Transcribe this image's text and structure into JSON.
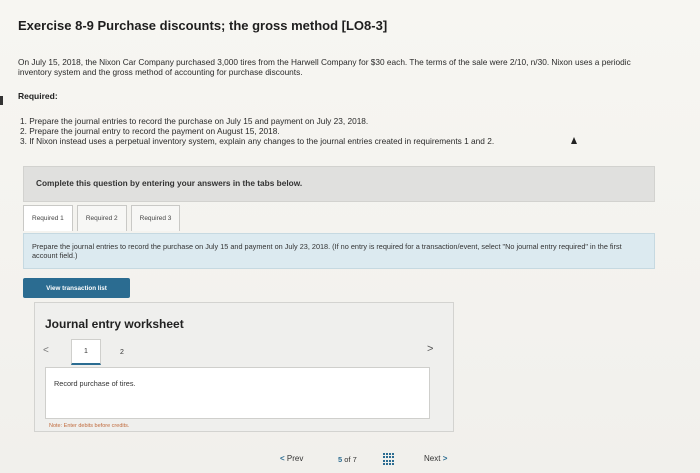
{
  "title": "Exercise 8-9 Purchase discounts; the gross method [LO8-3]",
  "intro": "On July 15, 2018, the Nixon Car Company purchased 3,000 tires from the Harwell Company for $30 each. The terms of the sale were 2/10, n/30. Nixon uses a periodic inventory system and the gross method of accounting for purchase discounts.",
  "required_label": "Required:",
  "requirements": [
    "1. Prepare the journal entries to record the purchase on July 15 and payment on July 23, 2018.",
    "2. Prepare the journal entry to record the payment on August 15, 2018.",
    "3. If Nixon instead uses a perpetual inventory system, explain any changes to the journal entries created in requirements 1 and 2."
  ],
  "instruction": "Complete this question by entering your answers in the tabs below.",
  "tabs": [
    "Required 1",
    "Required 2",
    "Required 3"
  ],
  "tab_prompt": "Prepare the journal entries to record the purchase on July 15 and payment on July 23, 2018. (If no entry is required for a transaction/event, select \"No journal entry required\" in the first account field.)",
  "view_button": "View transaction list",
  "worksheet": {
    "title": "Journal entry worksheet",
    "prev_arrow": "<",
    "next_arrow": ">",
    "pages": [
      "1",
      "2"
    ],
    "description": "Record purchase of tires.",
    "note": "Note: Enter debits before credits."
  },
  "footer": {
    "prev_label": "Prev",
    "prev_chevron": "<",
    "current_page": "5",
    "of_label": "of",
    "total_pages": "7",
    "next_label": "Next",
    "next_chevron": ">"
  }
}
